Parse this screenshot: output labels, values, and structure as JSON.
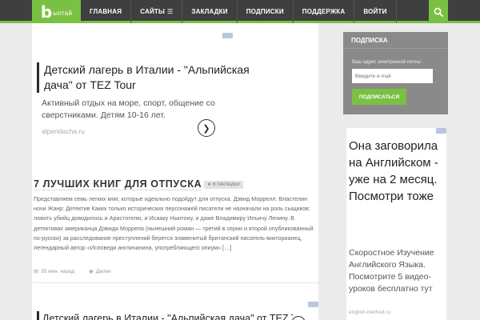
{
  "logo": {
    "letter": "b",
    "text": "ылтай"
  },
  "nav": {
    "items": [
      {
        "label": "ГЛАВНАЯ"
      },
      {
        "label": "САЙТЫ"
      },
      {
        "label": "ЗАКЛАДКИ"
      },
      {
        "label": "ПОДПИСКИ"
      },
      {
        "label": "ПОДДЕРЖКА"
      },
      {
        "label": "ВОЙТИ"
      }
    ],
    "sites_icon": "grid-icon",
    "search_icon": "search-icon"
  },
  "ad_top": {
    "title": "Детский лагерь в Италии - \"Альпийская дача\" от TEZ Tour",
    "description": "Активный отдых на море, спорт, общение со сверстниками. Детям 10-16 лет.",
    "url": "alpendacha.ru"
  },
  "post": {
    "title": "7 ЛУЧШИХ КНИГ ДЛЯ ОТПУСКА",
    "bookmark_label": "В ЗАКЛАДКИ",
    "excerpt": "Представляем семь легких книг, которые идеально подойдут для отпуска. Дэвид Моррелл. Властелин ночи Жанр: Детектив Каких только исторических персонажей писатели не назначали на роль сыщиков: ловить убийц доводилось и Аристотелю, и Исааку Ньютону, и даже Владимиру Ильичу Ленину. В детективах американца Дэвида Моррела (нынешний роман — третий в серии и второй опубликованный по-русски) за расследование преступлений берется знаменитый британский писатель-викторианец, легендарный автор «Исповеди англичанина, употребляющего опиум» […]",
    "time": "35 мин. назад",
    "more": "Далее"
  },
  "ad_bottom": {
    "title": "Детский лагерь в Италии - \"Альпийская дача\" от TEZ Tour"
  },
  "subscribe": {
    "heading": "ПОДПИСКА",
    "label": "Ваш адрес электронной почты:",
    "placeholder": "Введите e-mail",
    "button": "ПОДПИСАТЬСЯ"
  },
  "side_ad": {
    "title": "Она заговорила на Английском - уже на 2 месяц. Посмотри тоже",
    "description": "Скоростное Изучение Английского Языка. Посмотрите 5 видео-уроков бесплатно тут",
    "url": "english-method.ru"
  },
  "colors": {
    "accent": "#7ac143",
    "nav_bg": "#3f3f3f",
    "page_bg": "#ebebeb",
    "widget_bg": "#8a8a8a"
  }
}
